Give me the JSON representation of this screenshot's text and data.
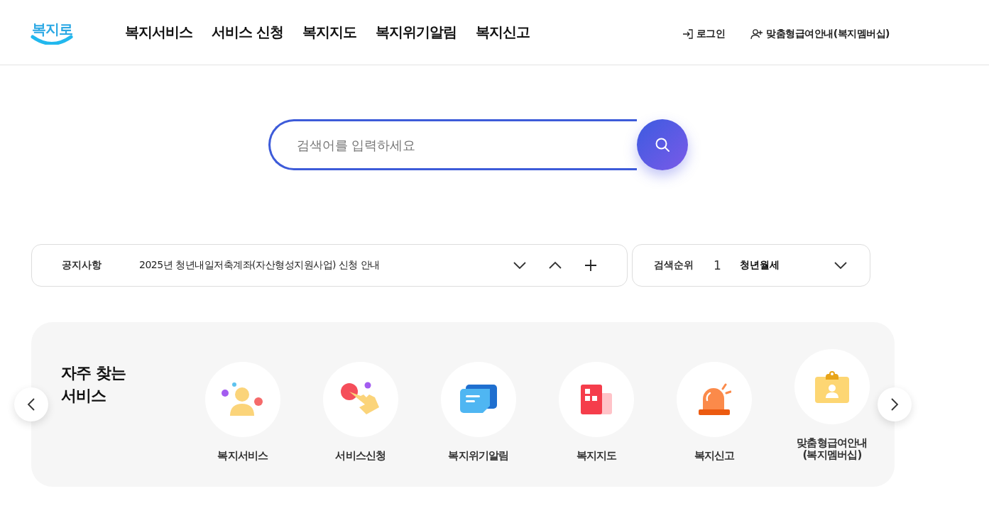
{
  "logo": {
    "text": "복지로"
  },
  "nav": [
    "복지서비스",
    "서비스 신청",
    "복지지도",
    "복지위기알림",
    "복지신고"
  ],
  "account": [
    {
      "kind": "login",
      "label": "로그인"
    },
    {
      "kind": "member",
      "label": "맞춤형급여안내(복지멤버십)"
    }
  ],
  "search": {
    "placeholder": "검색어를 입력하세요"
  },
  "notice": {
    "label": "공지사항",
    "text": "2025년 청년내일저축계좌(자산형성지원사업) 신청 안내"
  },
  "ranking": {
    "label": "검색순위",
    "rank": "1",
    "keyword": "청년월세"
  },
  "frequent": {
    "title": "자주 찾는\n서비스",
    "items": [
      {
        "kind": "person",
        "label": "복지서비스"
      },
      {
        "kind": "hand",
        "label": "서비스신청"
      },
      {
        "kind": "message",
        "label": "복지위기알림"
      },
      {
        "kind": "building",
        "label": "복지지도"
      },
      {
        "kind": "siren",
        "label": "복지신고"
      },
      {
        "kind": "idcard",
        "label": "맞춤형급여안내\n(복지멤버십)"
      }
    ]
  }
}
